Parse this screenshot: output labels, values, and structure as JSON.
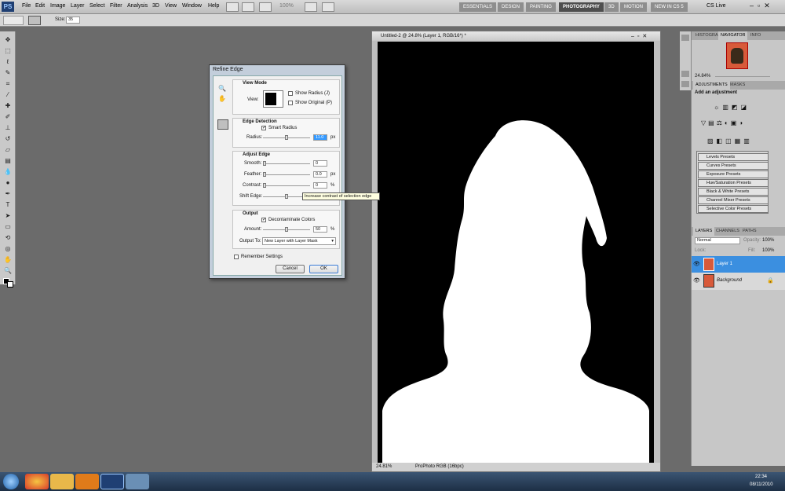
{
  "app": {
    "logo": "PS"
  },
  "menu": [
    "File",
    "Edit",
    "Image",
    "Layer",
    "Select",
    "Filter",
    "Analysis",
    "3D",
    "View",
    "Window",
    "Help"
  ],
  "toolbar_top": {
    "zoom": "100%"
  },
  "workspaces": [
    "ESSENTIALS",
    "DESIGN",
    "PAINTING",
    "PHOTOGRAPHY",
    "3D",
    "MOTION",
    "NEW IN CS 5"
  ],
  "active_workspace": "PHOTOGRAPHY",
  "cs_live": "CS Live",
  "options": {
    "size_label": "Size:",
    "size_value": "35"
  },
  "document": {
    "title": "Untitled-2 @ 24.8% (Layer 1, RGB/16*) *",
    "zoom": "24.81%",
    "profile": "ProPhoto RGB (16bpc)"
  },
  "dialog": {
    "title": "Refine Edge",
    "view_mode": {
      "title": "View Mode",
      "view_label": "View:",
      "show_radius": "Show Radius (J)",
      "show_original": "Show Original (P)"
    },
    "edge_detection": {
      "title": "Edge Detection",
      "smart_radius": "Smart Radius",
      "radius_label": "Radius:",
      "radius_value": "11.0",
      "radius_unit": "px"
    },
    "adjust_edge": {
      "title": "Adjust Edge",
      "smooth_label": "Smooth:",
      "smooth_value": "0",
      "feather_label": "Feather:",
      "feather_value": "0.0",
      "feather_unit": "px",
      "contrast_label": "Contrast:",
      "contrast_value": "0",
      "contrast_unit": "%",
      "shift_label": "Shift Edge:"
    },
    "output": {
      "title": "Output",
      "decontaminate": "Decontaminate Colors",
      "amount_label": "Amount:",
      "amount_value": "50",
      "amount_unit": "%",
      "output_to_label": "Output To:",
      "output_to_value": "New Layer with Layer Mask"
    },
    "remember": "Remember Settings",
    "cancel": "Cancel",
    "ok": "OK"
  },
  "tooltip": "Increase contrast of selection edge",
  "panels": {
    "top_tabs": [
      "HISTOGRA",
      "NAVIGATOR",
      "INFO"
    ],
    "nav_zoom": "24.84%",
    "adj_tabs": [
      "ADJUSTMENTS",
      "MASKS"
    ],
    "add_adjustment": "Add an adjustment",
    "presets": [
      "Levels Presets",
      "Curves Presets",
      "Exposure Presets",
      "Hue/Saturation Presets",
      "Black & White Presets",
      "Channel Mixer Presets",
      "Selective Color Presets"
    ],
    "layer_tabs": [
      "LAYERS",
      "CHANNELS",
      "PATHS"
    ],
    "blend_mode": "Normal",
    "opacity_label": "Opacity:",
    "opacity_value": "100%",
    "lock_label": "Lock:",
    "fill_label": "Fill:",
    "fill_value": "100%",
    "layers": [
      "Layer 1",
      "Background"
    ]
  },
  "taskbar": {
    "time": "22:34",
    "date": "08/11/2010"
  }
}
